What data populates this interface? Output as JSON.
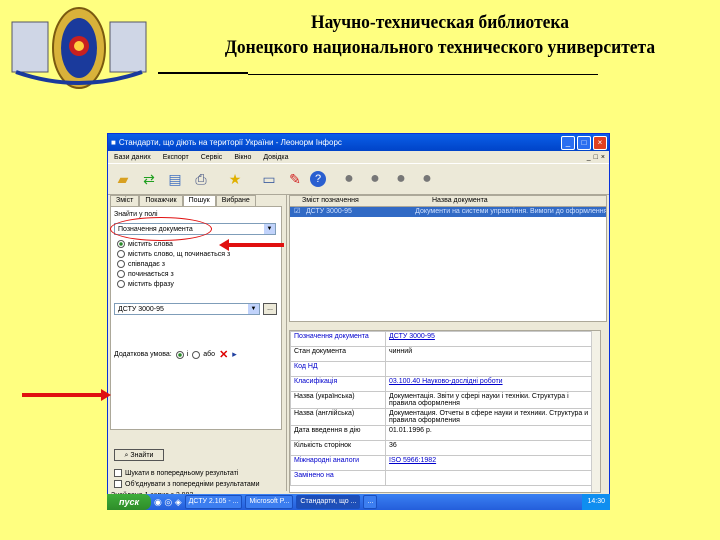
{
  "header": {
    "line1": "Научно-техническая библиотека",
    "line2": "Донецкого национального технического университета"
  },
  "window": {
    "title": "Стандарти, що діють на території України - Леонорм Інфорс",
    "menu": [
      "Бази даних",
      "Експорт",
      "Сервіс",
      "Вікно",
      "Довідка"
    ],
    "mdi": [
      "_",
      "□",
      "×"
    ],
    "toolbar_icons": [
      "open-folder-icon",
      "refresh-icon",
      "document-icon",
      "print-icon",
      "star-icon",
      "monitor-icon",
      "pen-icon",
      "help-icon",
      "circle-icon",
      "circle-icon",
      "circle-icon",
      "circle-icon"
    ]
  },
  "left": {
    "tabs": [
      "Зміст",
      "Покажчик",
      "Пошук",
      "Вибране"
    ],
    "active_tab": "Пошук",
    "field_label": "Знайти у полі",
    "field_value": "Позначення документа",
    "radios": [
      "містить слова",
      "містить слово, щ починається з",
      "співпадає з",
      "починається з",
      "містить фразу"
    ],
    "radio_selected": 0,
    "query_value": "ДСТУ 3000-95",
    "extra_label": "Додаткова умова:",
    "extra_options": [
      "і",
      "або"
    ],
    "find_button": "Знайти",
    "checkboxes": [
      "Шукати в попередньому результаті",
      "Об'єднувати з попередніми результатами"
    ]
  },
  "grid": {
    "columns": [
      "Зміст позначення",
      "Назва документа"
    ],
    "rows": [
      {
        "code": "ДСТУ 3000-95",
        "name": "Документи на системи управління. Вимоги до оформлення"
      }
    ]
  },
  "details": {
    "rows": [
      {
        "key": "Позначення документа",
        "value": "ДСТУ 3000-95",
        "style": "link"
      },
      {
        "key": "Стан документа",
        "value": "чинний",
        "style": ""
      },
      {
        "key": "Код НД",
        "value": "",
        "style": "link"
      },
      {
        "key": "Класифікація",
        "value": "03.100.40 Науково-дослідні роботи",
        "style": "link"
      },
      {
        "key": "Назва (українська)",
        "value": "Документація. Звіти у сфері науки і техніки. Структура і правила оформлення",
        "style": ""
      },
      {
        "key": "Назва (англійська)",
        "value": "Документация. Отчеты в сфере науки и техники. Структура и правила оформления",
        "style": ""
      },
      {
        "key": "Дата введення в дію",
        "value": "01.01.1996 р.",
        "style": ""
      },
      {
        "key": "Кількість сторінок",
        "value": "36",
        "style": ""
      },
      {
        "key": "Міжнародні аналоги",
        "value": "ISO 5966:1982",
        "style": "link"
      },
      {
        "key": "Замінено на",
        "value": "",
        "style": "link"
      }
    ]
  },
  "status": "Знайдено 1 запис з 2 982",
  "taskbar": {
    "start": "пуск",
    "tasks": [
      "ДСТУ 2.105 - ...",
      "Microsoft P...",
      "Стандарти, що ...",
      "..."
    ],
    "time": "14:30"
  }
}
